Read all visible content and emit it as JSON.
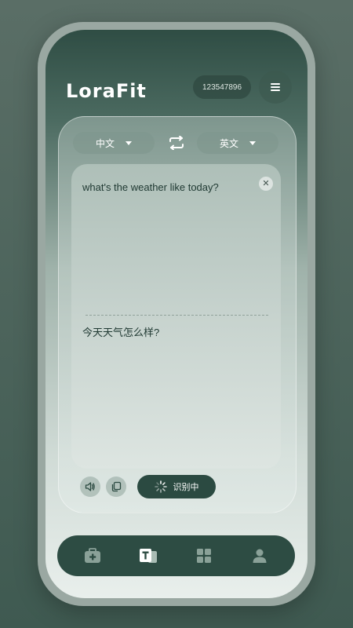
{
  "app": {
    "brand": "LoraFit",
    "user_id": "123547896"
  },
  "icons": {
    "menu": "hamburger-icon",
    "swap": "swap-arrows-icon",
    "clear": "close-icon",
    "speaker": "speaker-icon",
    "copy": "copy-icon",
    "spinner": "loading-spinner-icon"
  },
  "translator": {
    "source_language": "中文",
    "target_language": "英文",
    "source_text": "what's the weather like today?",
    "result_text": "今天天气怎么样?",
    "clear_symbol": "✕",
    "recognize_label": "识别中"
  },
  "nav": {
    "items": [
      {
        "icon": "medical-kit-icon",
        "active": false
      },
      {
        "icon": "text-translate-icon",
        "active": true
      },
      {
        "icon": "grid-apps-icon",
        "active": false
      },
      {
        "icon": "user-profile-icon",
        "active": false
      }
    ]
  },
  "colors": {
    "primary_dark": "#2b4a41",
    "accent_white": "#ffffff",
    "inactive_icon": "#8aa198"
  }
}
